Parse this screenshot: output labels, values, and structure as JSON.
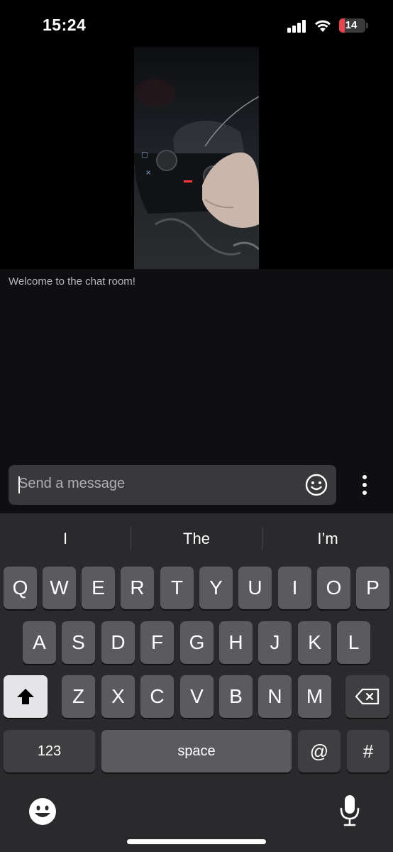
{
  "status_bar": {
    "time": "15:24",
    "battery_level": "14",
    "battery_color": "#e5454f"
  },
  "video": {
    "description_icon": "live-video-stream"
  },
  "chat": {
    "welcome_message": "Welcome to the chat room!",
    "input_placeholder": "Send a message",
    "emoji_icon": "smiley-face-icon",
    "more_icon": "vertical-ellipsis-icon"
  },
  "keyboard": {
    "suggestions": [
      "I",
      "The",
      "I’m"
    ],
    "row1": [
      "Q",
      "W",
      "E",
      "R",
      "T",
      "Y",
      "U",
      "I",
      "O",
      "P"
    ],
    "row2": [
      "A",
      "S",
      "D",
      "F",
      "G",
      "H",
      "J",
      "K",
      "L"
    ],
    "row3": [
      "Z",
      "X",
      "C",
      "V",
      "B",
      "N",
      "M"
    ],
    "numbers_label": "123",
    "space_label": "space",
    "at_label": "@",
    "hash_label": "#",
    "shift_icon": "shift-arrow-icon",
    "delete_icon": "backspace-icon",
    "emoji_icon": "emoji-icon",
    "mic_icon": "microphone-icon"
  }
}
